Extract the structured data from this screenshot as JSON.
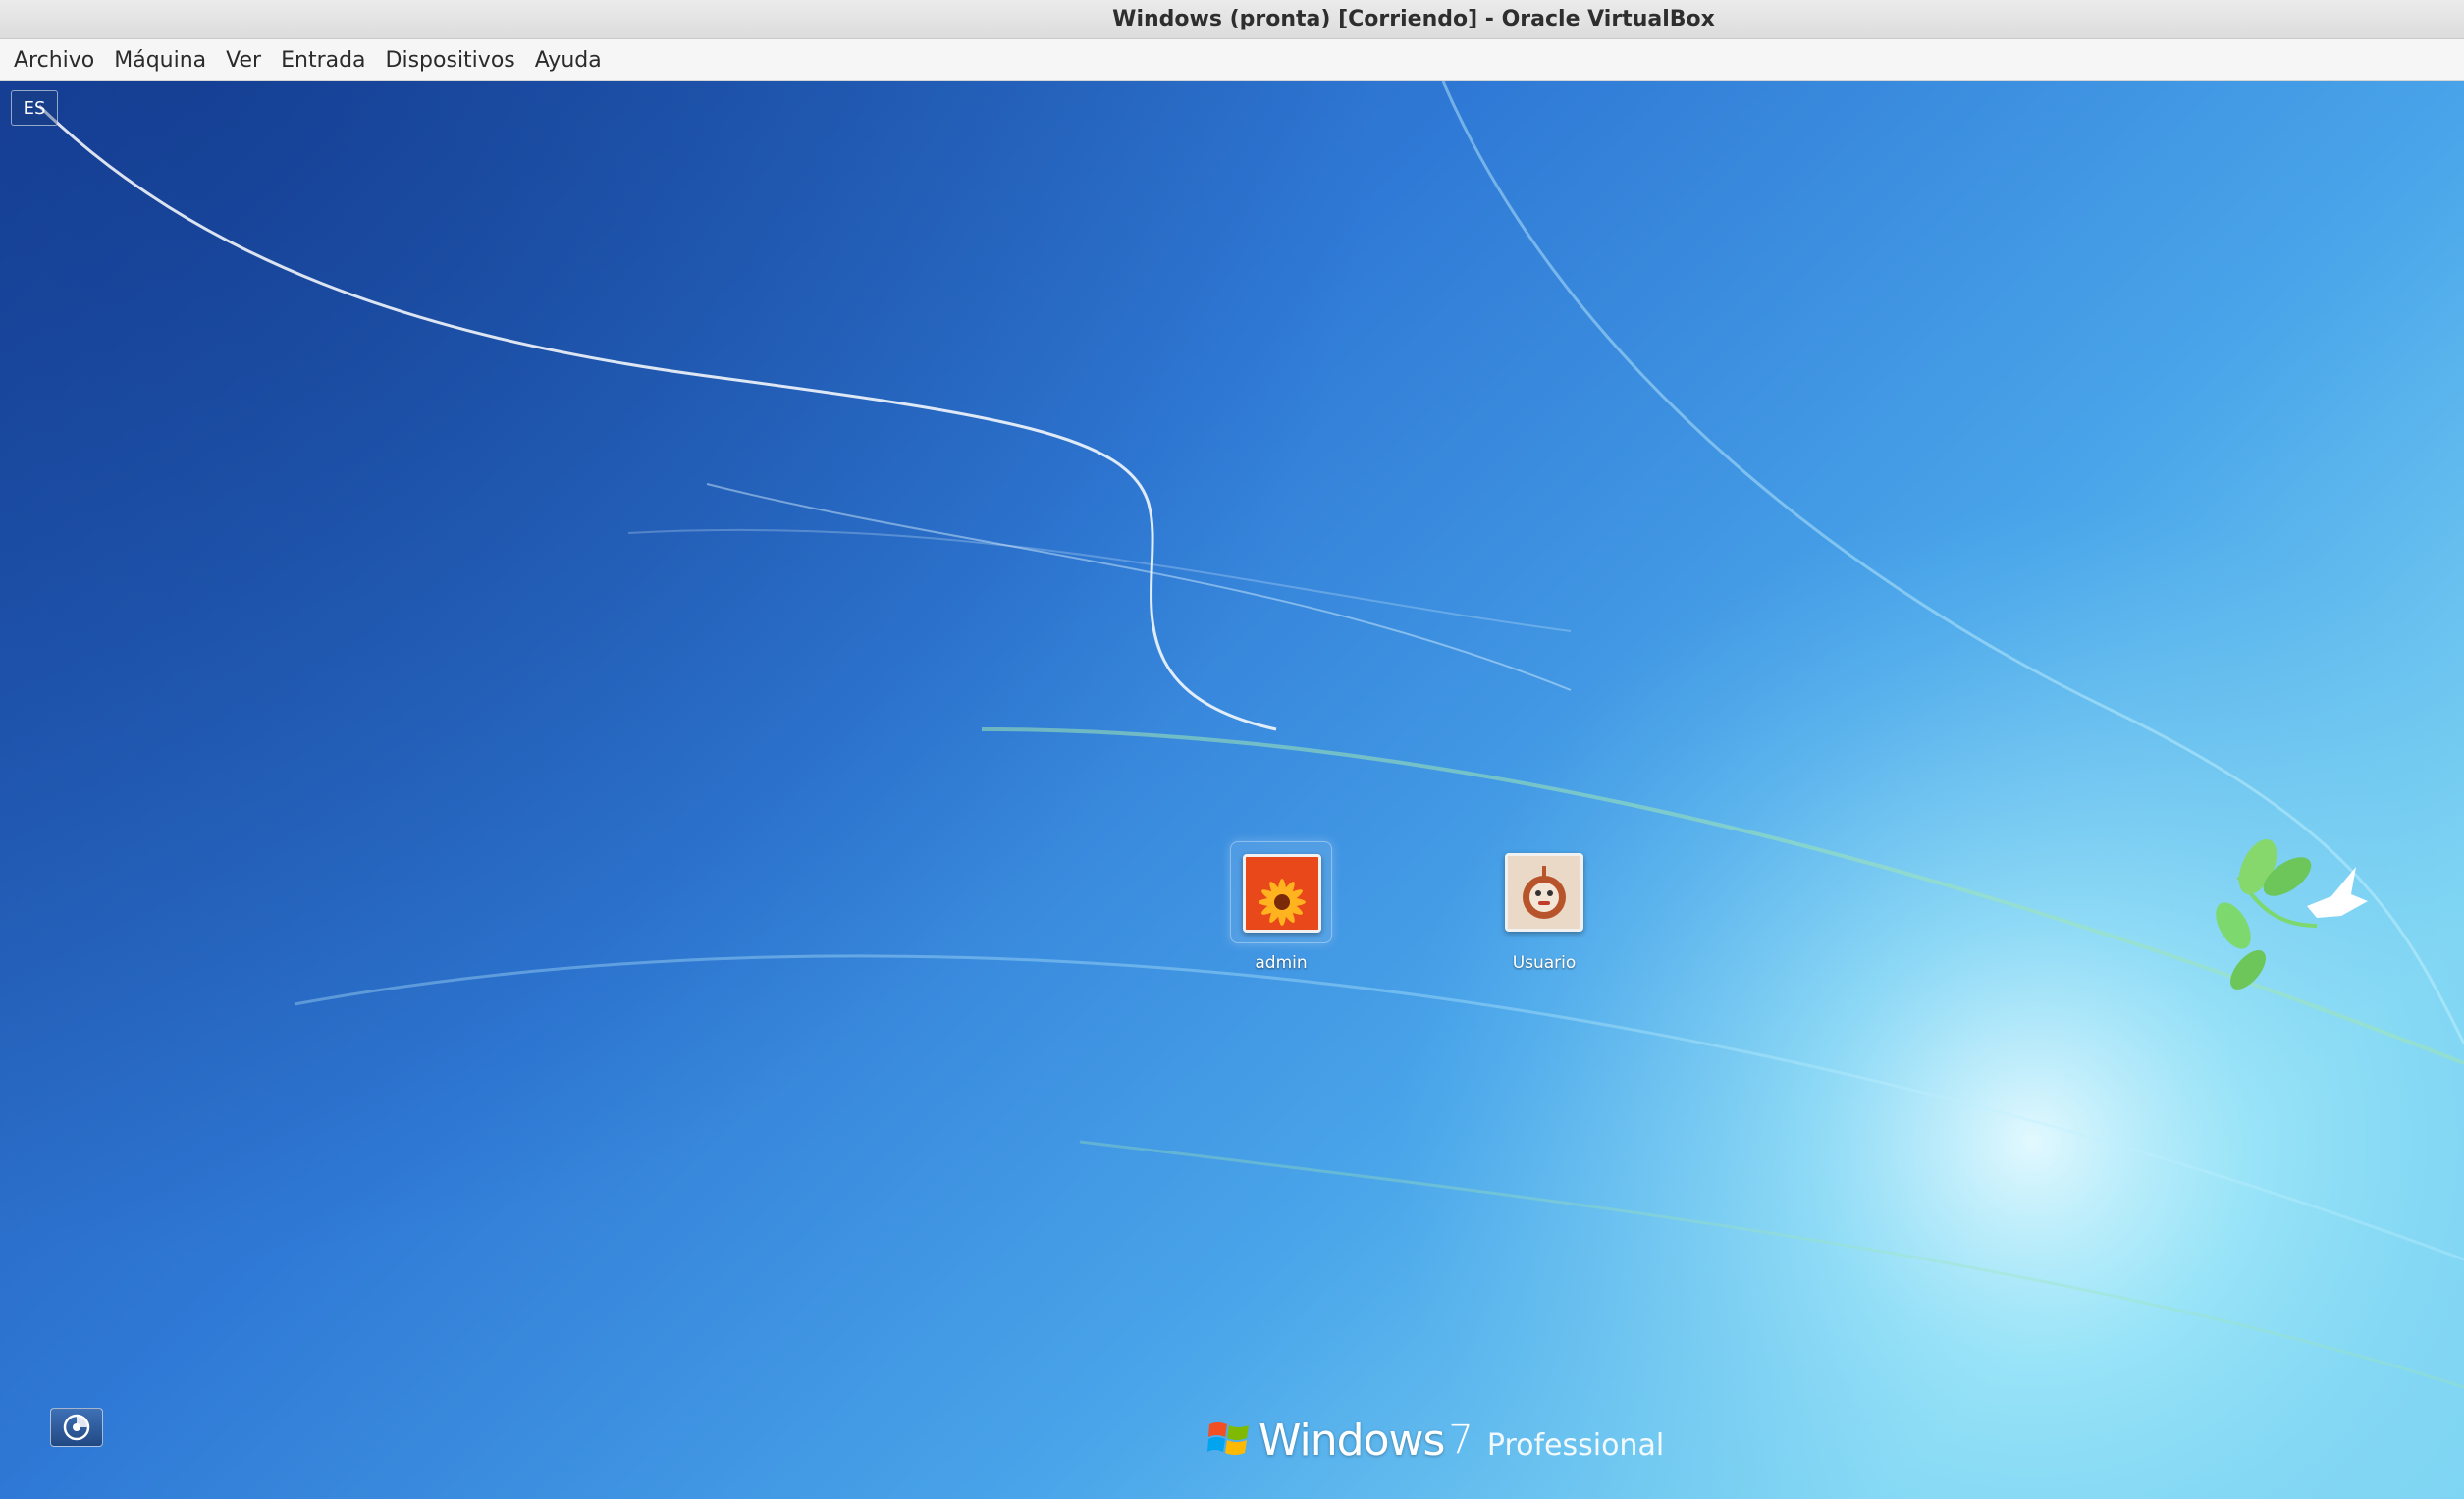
{
  "window": {
    "title": "Windows (pronta) [Corriendo] - Oracle VirtualBox"
  },
  "menubar": {
    "items": [
      {
        "label": "Archivo"
      },
      {
        "label": "Máquina"
      },
      {
        "label": "Ver"
      },
      {
        "label": "Entrada"
      },
      {
        "label": "Dispositivos"
      },
      {
        "label": "Ayuda"
      }
    ]
  },
  "login": {
    "language_indicator": "ES",
    "users": [
      {
        "name": "admin",
        "picture_icon": "orange-flower-icon",
        "selected": true
      },
      {
        "name": "Usuario",
        "picture_icon": "robot-character-icon",
        "selected": false
      }
    ],
    "ease_of_access_icon": "ease-of-access-icon"
  },
  "branding": {
    "logo_icon": "windows-flag-logo",
    "name": "Windows",
    "version": "7",
    "edition": "Professional"
  },
  "colors": {
    "wallpaper_dark": "#1c4ea8",
    "wallpaper_light": "#8fe3f5",
    "titlebar": "#e3e3e3",
    "menubar": "#f6f6f6"
  }
}
